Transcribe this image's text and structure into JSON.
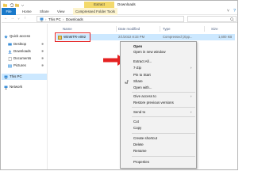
{
  "window": {
    "contextual_tab": "Extract",
    "title": "Downloads"
  },
  "ribbon": {
    "tabs": [
      "File",
      "Home",
      "Share",
      "View",
      "Compressed Folder Tools"
    ]
  },
  "address": {
    "crumbs": [
      "This PC",
      "Downloads"
    ]
  },
  "nav": {
    "items": [
      {
        "label": "Quick access",
        "icon": "star-icon"
      },
      {
        "label": "Desktop",
        "icon": "desktop-icon",
        "pinned": true
      },
      {
        "label": "Downloads",
        "icon": "download-icon",
        "pinned": true
      },
      {
        "label": "Documents",
        "icon": "documents-icon",
        "pinned": true
      },
      {
        "label": "Pictures",
        "icon": "pictures-icon",
        "pinned": true
      },
      {
        "label": "This PC",
        "icon": "computer-icon"
      },
      {
        "label": "Network",
        "icon": "network-icon"
      }
    ],
    "pin_glyph": "✱"
  },
  "columns": [
    "Name",
    "Date modified",
    "Type",
    "Size"
  ],
  "file": {
    "name": "WinMTR-v092",
    "date": "2/1/2022 8:33 PM",
    "type": "Compressed (zipp...",
    "size": "1,600 KB"
  },
  "context_menu": {
    "items": [
      {
        "label": "Open",
        "bold": true
      },
      {
        "label": "Open in new window"
      },
      {
        "label": "Extract All..."
      },
      {
        "label": "7-Zip",
        "submenu": true
      },
      {
        "label": "Pin to Start"
      },
      {
        "label": "Share",
        "icon": "share-icon"
      },
      {
        "label": "Open with..."
      },
      {
        "label": "Give access to",
        "submenu": true
      },
      {
        "label": "Restore previous versions"
      },
      {
        "label": "Send to",
        "submenu": true
      },
      {
        "label": "Cut"
      },
      {
        "label": "Copy"
      },
      {
        "label": "Create shortcut"
      },
      {
        "label": "Delete"
      },
      {
        "label": "Rename"
      },
      {
        "label": "Properties"
      }
    ],
    "submenu_glyph": "›"
  },
  "colors": {
    "accent": "#1979ca",
    "selection": "#cce8ff",
    "highlight_box": "#e52222",
    "arrow": "#e52222",
    "extract_tab": "#f3d96b"
  }
}
